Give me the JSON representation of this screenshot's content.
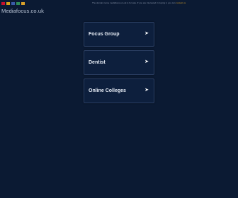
{
  "header": {
    "flags": [
      {
        "name": "uk-flag",
        "color": "#c8102e"
      },
      {
        "name": "de-flag",
        "color": "#d4a017"
      },
      {
        "name": "fr-flag",
        "color": "#3a5ba9"
      },
      {
        "name": "it-flag",
        "color": "#2e8b57"
      },
      {
        "name": "es-flag",
        "color": "#d9a12b"
      }
    ],
    "notice_text": "The domain name mediafocus.co.uk is for sale. If you are interested in buying it, you can",
    "notice_link": "contact us"
  },
  "site": {
    "name": "Mediafocus.co.uk"
  },
  "links": [
    {
      "label": "Focus Group",
      "arrow": "➤"
    },
    {
      "label": "Dentist",
      "arrow": "➤"
    },
    {
      "label": "Online Colleges",
      "arrow": "➤"
    }
  ]
}
